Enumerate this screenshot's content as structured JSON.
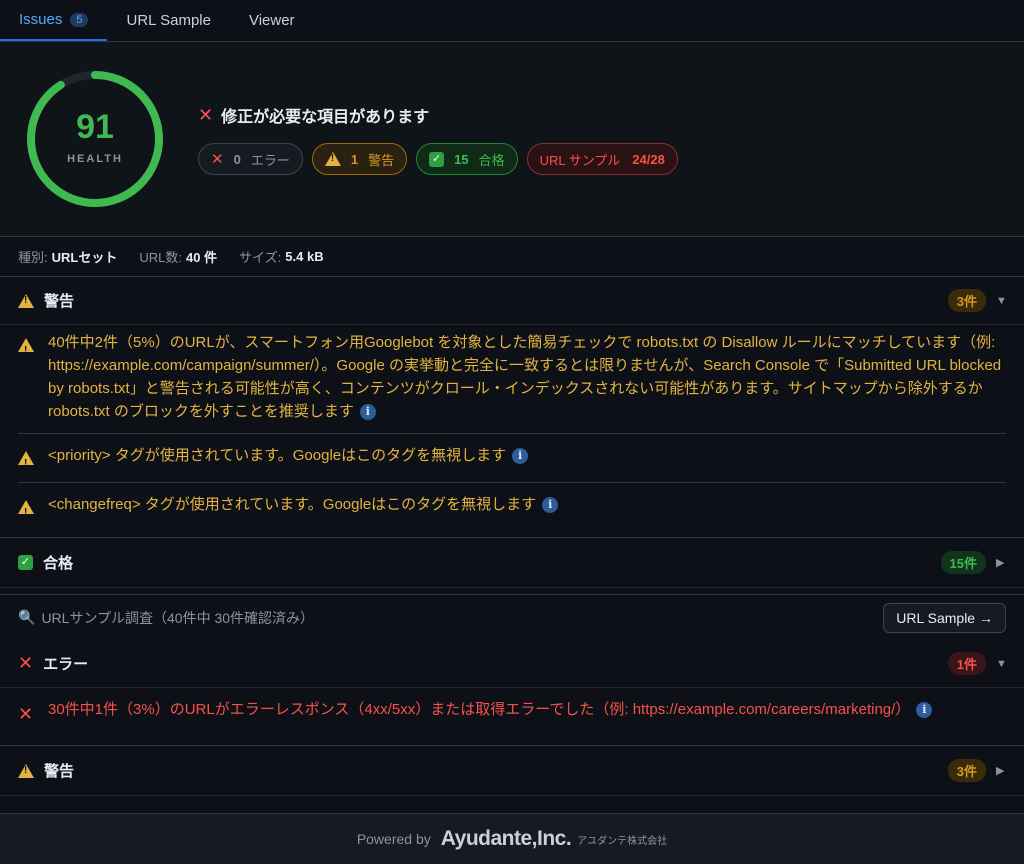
{
  "tabs": [
    {
      "label": "Issues",
      "count": "5"
    },
    {
      "label": "URL Sample"
    },
    {
      "label": "Viewer"
    }
  ],
  "health": {
    "score": "91",
    "score_value": 91,
    "label": "HEALTH",
    "title": "修正が必要な項目があります",
    "pills": {
      "error_count": "0",
      "error_label": "エラー",
      "warn_count": "1",
      "warn_label": "警告",
      "pass_count": "15",
      "pass_label": "合格",
      "url_label": "URL サンプル",
      "url_value": "24/28"
    }
  },
  "meta": {
    "type_key": "種別:",
    "type_val": "URLセット",
    "count_key": "URL数:",
    "count_val": "40 件",
    "size_key": "サイズ:",
    "size_val": "5.4 kB"
  },
  "warnings": {
    "label": "警告",
    "count": "3件",
    "items": [
      "40件中2件（5%）のURLが、スマートフォン用Googlebot を対象とした簡易チェックで robots.txt の Disallow ルールにマッチしています（例: https://example.com/campaign/summer/）。Google の実挙動と完全に一致するとは限りませんが、Search Console で「Submitted URL blocked by robots.txt」と警告される可能性が高く、コンテンツがクロール・インデックスされない可能性があります。サイトマップから除外するか robots.txt のブロックを外すことを推奨します",
      "<priority> タグが使用されています。Googleはこのタグを無視します",
      "<changefreq> タグが使用されています。Googleはこのタグを無視します"
    ]
  },
  "passed": {
    "label": "合格",
    "count": "15件"
  },
  "sample": {
    "title": "URLサンプル調査（40件中 30件確認済み）",
    "button": "URL Sample →"
  },
  "errors": {
    "label": "エラー",
    "count": "1件",
    "items": [
      "30件中1件（3%）のURLがエラーレスポンス（4xx/5xx）または取得エラーでした（例: https://example.com/careers/marketing/）"
    ]
  },
  "sample_warnings": {
    "label": "警告",
    "count": "3件"
  },
  "footer": {
    "powered": "Powered by",
    "brand": "Ayudante,Inc.",
    "corp": "アユダンテ株式会社"
  }
}
